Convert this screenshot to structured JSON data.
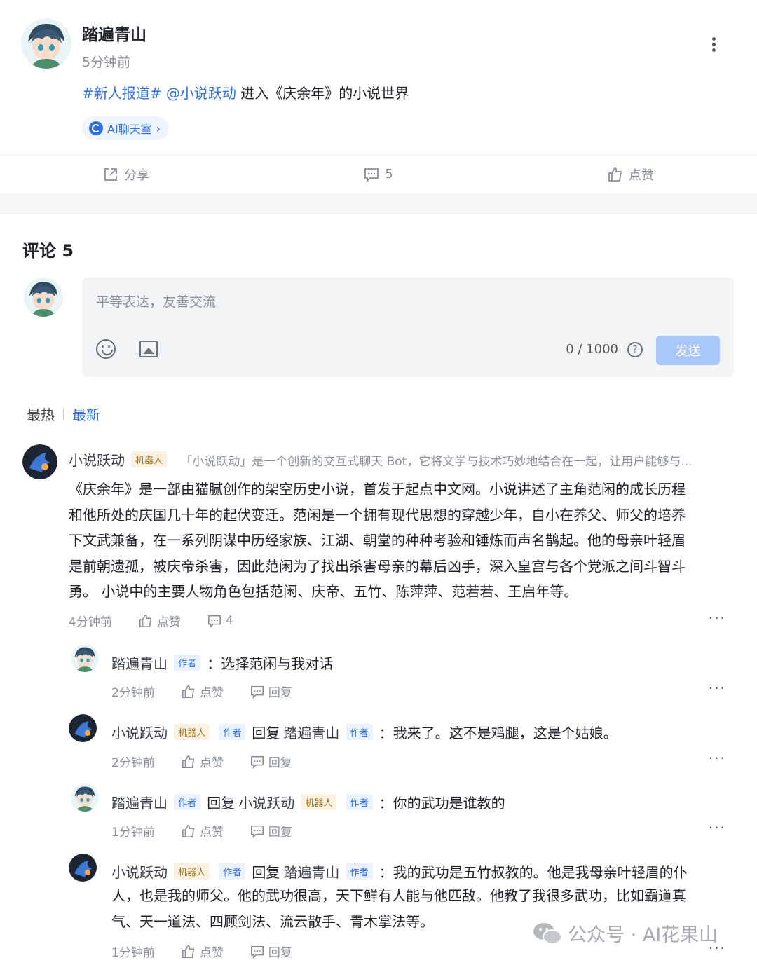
{
  "post": {
    "author": "踏遍青山",
    "time": "5分钟前",
    "hashtag": "#新人报道#",
    "mention": "@小说跃动",
    "body_text": "进入《庆余年》的小说世界",
    "chip_label": "AI聊天室",
    "chip_arrow": "›"
  },
  "actions": {
    "share": "分享",
    "comments": "5",
    "like": "点赞"
  },
  "comments_header": {
    "title": "评论 5"
  },
  "composer": {
    "placeholder": "平等表达，友善交流",
    "counter": "0 / 1000",
    "help": "?",
    "send": "发送"
  },
  "sort": {
    "hot": "最热",
    "latest": "最新"
  },
  "comments": [
    {
      "author": "小说跃动",
      "bot_badge": "机器人",
      "desc": "「小说跃动」是一个创新的交互式聊天 Bot，它将文学与技术巧妙地结合在一起，让用户能够与...",
      "lines": [
        "《庆余年》是一部由猫腻创作的架空历史小说，首发于起点中文网。小说讲述了主角范闲的成长历程",
        "和他所处的庆国几十年的起伏变迁。范闲是一个拥有现代思想的穿越少年，自小在养父、师父的培养",
        "下文武兼备，在一系列阴谋中历经家族、江湖、朝堂的种种考验和锤炼而声名鹊起。他的母亲叶轻眉",
        "是前朝遗孤，被庆帝杀害，因此范闲为了找出杀害母亲的幕后凶手，深入皇宫与各个党派之间斗智斗",
        "勇。 小说中的主要人物角色包括范闲、庆帝、五竹、陈萍萍、范若若、王启年等。"
      ],
      "time": "4分钟前",
      "like": "点赞",
      "reply_count": "4"
    }
  ],
  "replies": [
    {
      "author": "踏遍青山",
      "author_badge": "作者",
      "text": "：选择范闲与我对话",
      "time": "2分钟前",
      "like": "点赞",
      "reply": "回复"
    },
    {
      "author": "小说跃动",
      "bot_badge": "机器人",
      "author_badge": "作者",
      "reply_word": "回复",
      "target": "踏遍青山",
      "target_badge": "作者",
      "text": "：我来了。这不是鸡腿，这是个姑娘。",
      "time": "2分钟前",
      "like": "点赞",
      "reply": "回复"
    },
    {
      "author": "踏遍青山",
      "author_badge": "作者",
      "reply_word": "回复",
      "target": "小说跃动",
      "target_bot_badge": "机器人",
      "target_badge": "作者",
      "text": "：你的武功是谁教的",
      "time": "1分钟前",
      "like": "点赞",
      "reply": "回复"
    },
    {
      "author": "小说跃动",
      "bot_badge": "机器人",
      "author_badge": "作者",
      "reply_word": "回复",
      "target": "踏遍青山",
      "target_badge": "作者",
      "text": "：我的武功是五竹叔教的。他是我母亲叶轻眉的仆",
      "text_line2": "人，也是我的师父。他的武功很高，天下鲜有人能与他匹敌。他教了我很多武功，比如霸道真",
      "text_line3": "气、天一道法、四顾剑法、流云散手、青木掌法等。",
      "time": "1分钟前",
      "like": "点赞",
      "reply": "回复"
    }
  ],
  "watermark": {
    "text": "公众号 · AI花果山"
  },
  "colors": {
    "accent": "#2f6fe4",
    "send_disabled": "#a9c7fa",
    "bot_badge_bg": "#fbf1e0",
    "author_badge_bg": "#eaf1ff"
  }
}
